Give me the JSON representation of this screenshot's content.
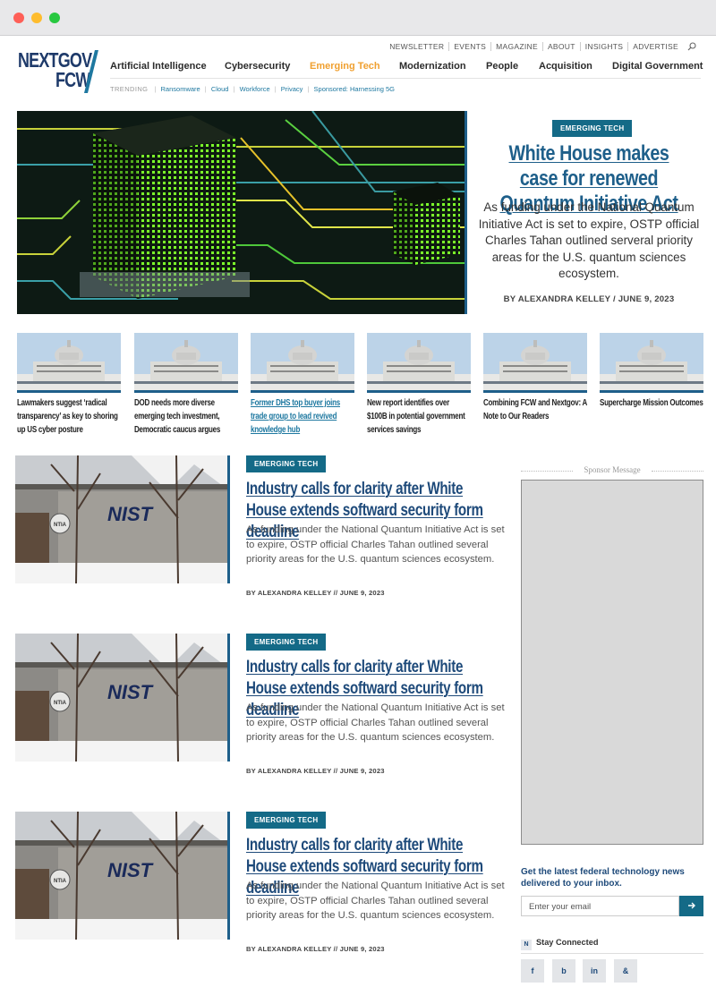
{
  "window": {
    "controls": [
      "close",
      "minimize",
      "zoom"
    ]
  },
  "brand": {
    "logo_line1": "NEXTGOV",
    "logo_line2": "FCW"
  },
  "utility_nav": [
    "NEWSLETTER",
    "EVENTS",
    "MAGAZINE",
    "ABOUT",
    "INSIGHTS",
    "ADVERTISE"
  ],
  "main_nav": [
    {
      "label": "Artificial Intelligence",
      "active": false
    },
    {
      "label": "Cybersecurity",
      "active": false
    },
    {
      "label": "Emerging Tech",
      "active": true
    },
    {
      "label": "Modernization",
      "active": false
    },
    {
      "label": "People",
      "active": false
    },
    {
      "label": "Acquisition",
      "active": false
    },
    {
      "label": "Digital Government",
      "active": false
    }
  ],
  "trending": {
    "label": "TRENDING",
    "items": [
      "Ransomware",
      "Cloud",
      "Workforce",
      "Privacy",
      "Sponsored: Harnessing 5G"
    ]
  },
  "hero": {
    "badge": "EMERGING TECH",
    "title": "White House makes case for renewed Quantum Initiative Act",
    "summary": "As funding under the National Quantum Initiative Act is set to expire, OSTP official Charles Tahan outlined serveral priority areas for the U.S. quantum sciences ecosystem.",
    "byline": "BY ALEXANDRA KELLEY / JUNE 9, 2023"
  },
  "thumbs": [
    {
      "caption": "Lawmakers suggest ‘radical transparency’ as key to shoring up US cyber posture"
    },
    {
      "caption": "DOD needs more diverse emerging tech investment, Democratic caucus argues"
    },
    {
      "caption": "Former DHS top buyer joins trade group to lead revived knowledge hub"
    },
    {
      "caption": "New report identifies over $100B in potential government services savings"
    },
    {
      "caption": "Combining FCW and Nextgov: A Note to Our Readers"
    },
    {
      "caption": "Supercharge Mission Outcomes"
    }
  ],
  "stories": [
    {
      "badge": "EMERGING TECH",
      "title": "Industry calls for clarity after White House extends softward security form deadline",
      "summary": "As funding under the National Quantum Initiative Act is set to expire, OSTP official Charles Tahan outlined several priority areas for the U.S. quantum sciences ecosystem.",
      "byline": "BY ALEXANDRA KELLEY // JUNE 9, 2023",
      "sign_text": "NIST",
      "seal_text": "NTIA"
    },
    {
      "badge": "EMERGING TECH",
      "title": "Industry calls for clarity after White House extends softward security form deadline",
      "summary": "As funding under the National Quantum Initiative Act is set to expire, OSTP official Charles Tahan outlined several priority areas for the U.S. quantum sciences ecosystem.",
      "byline": "BY ALEXANDRA KELLEY // JUNE 9, 2023",
      "sign_text": "NIST",
      "seal_text": "NTIA"
    },
    {
      "badge": "EMERGING TECH",
      "title": "Industry calls for clarity after White House extends softward security form deadline",
      "summary": "As funding under the National Quantum Initiative Act is set to expire, OSTP official Charles Tahan outlined several priority areas for the U.S. quantum sciences ecosystem.",
      "byline": "BY ALEXANDRA KELLEY // JUNE 9, 2023",
      "sign_text": "NIST",
      "seal_text": "NTIA"
    }
  ],
  "sidebar": {
    "sponsor_label": "Sponsor Message",
    "newsletter_heading": "Get the latest federal technology news delivered to your inbox.",
    "email_placeholder": "Enter your email",
    "submit_icon": "arrow-right-icon",
    "stay_connected": "Stay Connected",
    "stay_icon_letter": "N",
    "social": [
      {
        "glyph": "f",
        "icon": "facebook-icon"
      },
      {
        "glyph": "b",
        "icon": "twitter-icon"
      },
      {
        "glyph": "in",
        "icon": "linkedin-icon"
      },
      {
        "glyph": "&",
        "icon": "rss-icon"
      }
    ]
  },
  "colors": {
    "brand_navy": "#1e3a6a",
    "link_blue": "#1e78a0",
    "badge_teal": "#146a87",
    "active_nav": "#f0a030"
  }
}
